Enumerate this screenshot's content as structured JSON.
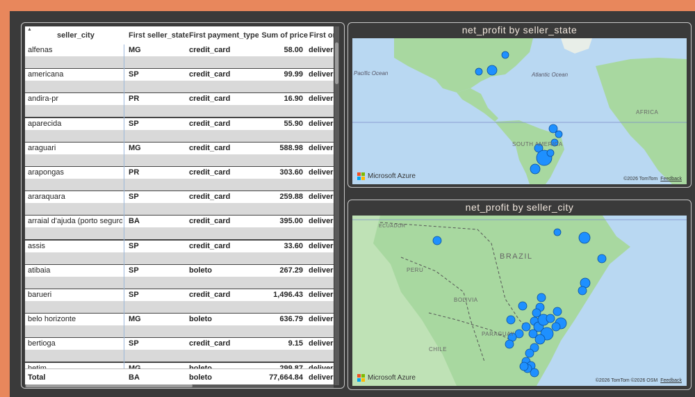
{
  "table": {
    "headers": [
      "seller_city",
      "First seller_state",
      "First payment_type",
      "Sum of price",
      "First or"
    ],
    "rows": [
      {
        "city": "alfenas",
        "state": "MG",
        "payment": "credit_card",
        "price": "58.00",
        "status": "deliver"
      },
      {
        "city": "americana",
        "state": "SP",
        "payment": "credit_card",
        "price": "99.99",
        "status": "deliver"
      },
      {
        "city": "andira-pr",
        "state": "PR",
        "payment": "credit_card",
        "price": "16.90",
        "status": "deliver"
      },
      {
        "city": "aparecida",
        "state": "SP",
        "payment": "credit_card",
        "price": "55.90",
        "status": "deliver"
      },
      {
        "city": "araguari",
        "state": "MG",
        "payment": "credit_card",
        "price": "588.98",
        "status": "deliver"
      },
      {
        "city": "arapongas",
        "state": "PR",
        "payment": "credit_card",
        "price": "303.60",
        "status": "deliver"
      },
      {
        "city": "araraquara",
        "state": "SP",
        "payment": "credit_card",
        "price": "259.88",
        "status": "deliver"
      },
      {
        "city": "arraial d'ajuda (porto seguro)",
        "state": "BA",
        "payment": "credit_card",
        "price": "395.00",
        "status": "deliver"
      },
      {
        "city": "assis",
        "state": "SP",
        "payment": "credit_card",
        "price": "33.60",
        "status": "deliver"
      },
      {
        "city": "atibaia",
        "state": "SP",
        "payment": "boleto",
        "price": "267.29",
        "status": "deliver"
      },
      {
        "city": "barueri",
        "state": "SP",
        "payment": "credit_card",
        "price": "1,496.43",
        "status": "deliver"
      },
      {
        "city": "belo horizonte",
        "state": "MG",
        "payment": "boleto",
        "price": "636.79",
        "status": "deliver"
      },
      {
        "city": "bertioga",
        "state": "SP",
        "payment": "credit_card",
        "price": "9.15",
        "status": "deliver"
      },
      {
        "city": "betim",
        "state": "MG",
        "payment": "boleto",
        "price": "299.87",
        "status": "deliver"
      }
    ],
    "total": {
      "label": "Total",
      "state": "BA",
      "payment": "boleto",
      "price": "77,664.84",
      "status": "deliver"
    }
  },
  "map_state": {
    "title": "net_profit by seller_state",
    "labels": {
      "pacific": "Pacific Ocean",
      "atlantic": "Atlantic Ocean",
      "africa": "AFRICA",
      "south_america": "SOUTH AMERICA"
    },
    "logo": "Microsoft Azure",
    "attribution": "©2026 TomTom",
    "feedback": "Feedback"
  },
  "map_city": {
    "title": "net_profit by seller_city",
    "labels": {
      "ecuador": "ECUADOR",
      "brazil": "BRAZIL",
      "peru": "PERU",
      "bolivia": "BOLIVIA",
      "paraguay": "PARAGUAY",
      "chile": "CHILE"
    },
    "logo": "Microsoft Azure",
    "attribution": "©2026 TomTom  ©2026 OSM",
    "feedback": "Feedback"
  },
  "colors": {
    "bubble": "#1E90FF",
    "water": "#B9D8F2",
    "land": "#A8D8A0",
    "canvas": "#3A3A3A",
    "frame": "#E8875C"
  }
}
